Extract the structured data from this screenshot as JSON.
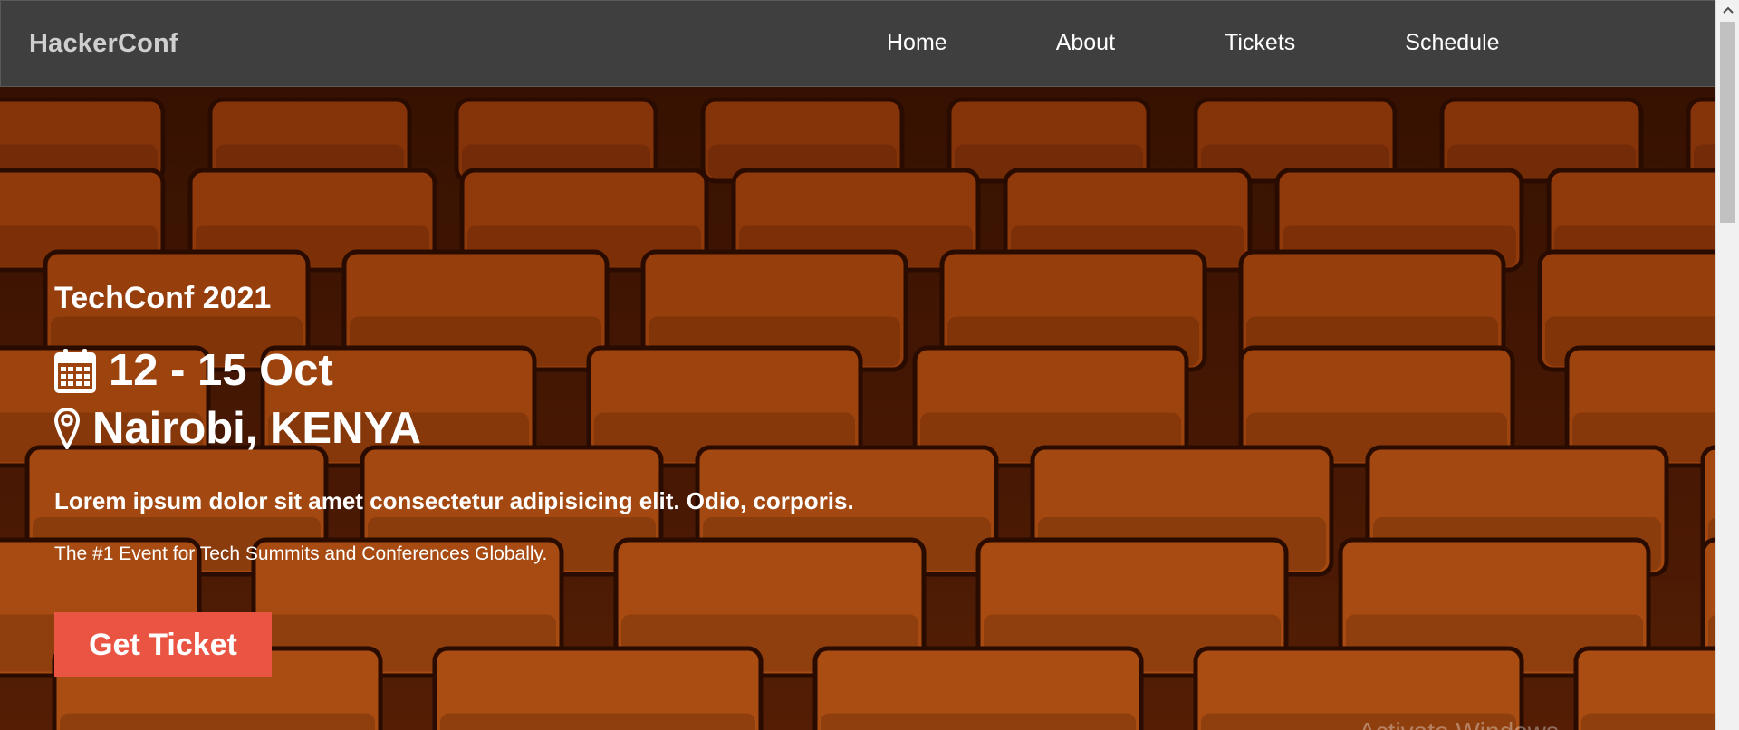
{
  "navbar": {
    "brand": "HackerConf",
    "links": [
      "Home",
      "About",
      "Tickets",
      "Schedule"
    ],
    "background": "#3f3f40"
  },
  "hero": {
    "title": "TechConf 2021",
    "date": "12 - 15 Oct",
    "location": "Nairobi, KENYA",
    "tagline_bold": "Lorem ipsum dolor sit amet consectetur adipisicing elit. Odio, corporis.",
    "tagline": "The #1 Event for Tech Summits and Conferences Globally.",
    "cta_label": "Get Ticket",
    "cta_color": "#ea5443",
    "background_image": "theater-seats",
    "date_icon": "calendar-icon",
    "location_icon": "map-pin-icon"
  },
  "overlay": {
    "watermark": "Activate Windows"
  }
}
